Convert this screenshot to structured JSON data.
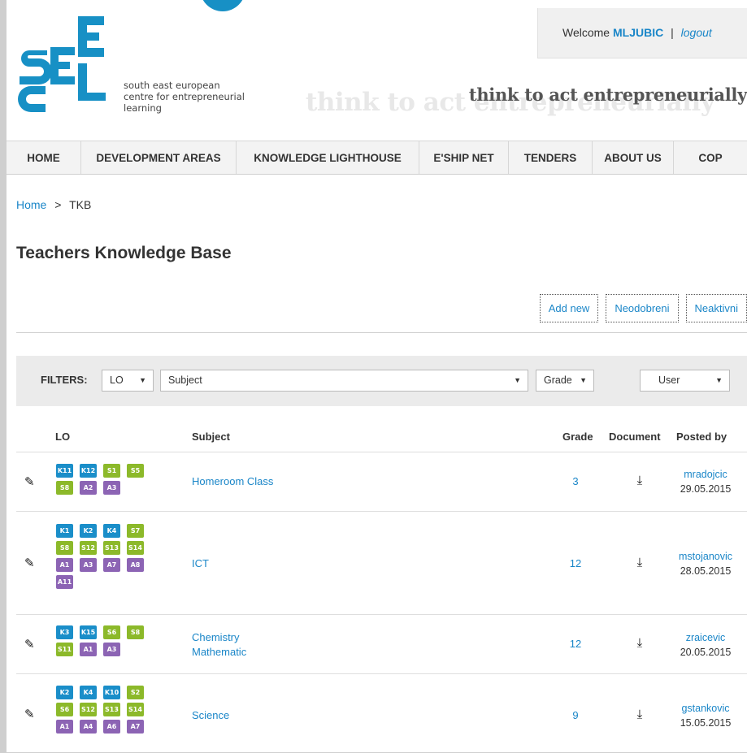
{
  "header": {
    "tagline": [
      "south east european",
      "centre for entrepreneurial",
      "learning"
    ],
    "slogan": "think to act entrepreneurially",
    "welcome_prefix": "Welcome",
    "username": "MLJUBIC",
    "separator": "|",
    "logout": "logout"
  },
  "nav": [
    "HOME",
    "DEVELOPMENT AREAS",
    "KNOWLEDGE LIGHTHOUSE",
    "E'SHIP NET",
    "TENDERS",
    "ABOUT US",
    "COP"
  ],
  "breadcrumb": {
    "home": "Home",
    "sep": ">",
    "current": "TKB"
  },
  "page_title": "Teachers Knowledge Base",
  "actions": [
    "Add new",
    "Neodobreni",
    "Neaktivni"
  ],
  "filters": {
    "label": "FILTERS:",
    "lo": "LO",
    "subject": "Subject",
    "grade": "Grade",
    "user": "User"
  },
  "table": {
    "headers": {
      "lo": "LO",
      "subject": "Subject",
      "grade": "Grade",
      "document": "Document",
      "posted_by": "Posted by"
    },
    "rows": [
      {
        "badges": [
          "K11",
          "K12",
          "S1",
          "S5",
          "S8",
          "A2",
          "A3"
        ],
        "subjects": [
          "Homeroom Class"
        ],
        "grade": "3",
        "user": "mradojcic",
        "date": "29.05.2015"
      },
      {
        "badges": [
          "K1",
          "K2",
          "K4",
          "S7",
          "S8",
          "S12",
          "S13",
          "S14",
          "A1",
          "A3",
          "A7",
          "A8",
          "A11"
        ],
        "subjects": [
          "ICT"
        ],
        "grade": "12",
        "user": "mstojanovic",
        "date": "28.05.2015"
      },
      {
        "badges": [
          "K3",
          "K15",
          "S6",
          "S8",
          "S11",
          "A1",
          "A3"
        ],
        "subjects": [
          "Chemistry",
          "Mathematic"
        ],
        "grade": "12",
        "user": "zraicevic",
        "date": "20.05.2015"
      },
      {
        "badges": [
          "K2",
          "K4",
          "K10",
          "S2",
          "S6",
          "S12",
          "S13",
          "S14",
          "A1",
          "A4",
          "A6",
          "A7"
        ],
        "subjects": [
          "Science"
        ],
        "grade": "9",
        "user": "gstankovic",
        "date": "15.05.2015"
      }
    ]
  },
  "colors": {
    "accent": "#1a86c8",
    "badge_k": "#1a8ec9",
    "badge_s": "#8cb92a",
    "badge_a": "#8c64b4"
  }
}
